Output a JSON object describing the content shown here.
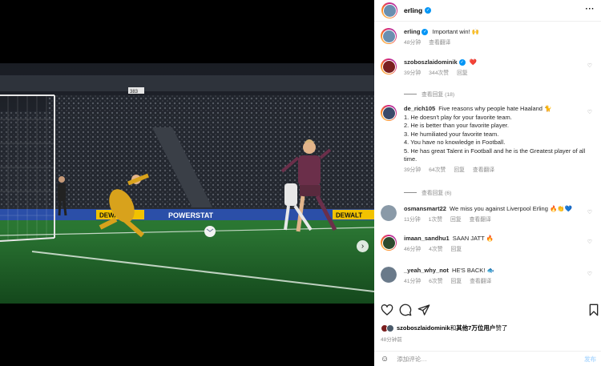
{
  "post": {
    "username": "erling",
    "caption_user": "erling",
    "caption": "Important win! 🙌",
    "caption_time": "48分钟",
    "caption_translate": "查看翻译",
    "carousel_dots": 4,
    "carousel_active": 0
  },
  "photo": {
    "ad_boards": [
      "DEWALT",
      "POWERSTAT",
      "DEWALT"
    ],
    "stand_label": "383"
  },
  "comments": [
    {
      "user": "szoboszlaidominik",
      "verified": true,
      "text": "❤️",
      "time": "39分钟",
      "likes": "344次赞",
      "reply": "回复",
      "translate": "",
      "replies": "查看回复 (18)",
      "avatar_color": "#7a1f1f"
    },
    {
      "user": "de_rich105",
      "verified": false,
      "text": "Five reasons why people hate Haaland 🐈",
      "lines": [
        "1. He doesn't play for your favorite team.",
        "2. He is better than your favorite player.",
        "3. He humiliated your favorite team.",
        "4. You have no knowledge in Football.",
        "5. He has great Talent in Football and he is the Greatest player of all time."
      ],
      "time": "39分钟",
      "likes": "64次赞",
      "reply": "回复",
      "translate": "查看翻译",
      "replies": "查看回复 (6)",
      "avatar_color": "#3a4a6a"
    },
    {
      "user": "osmansmart22",
      "verified": false,
      "text": "We miss you against Liverpool Erling 🔥👏💙",
      "time": "11分钟",
      "likes": "1次赞",
      "reply": "回复",
      "translate": "查看翻译",
      "avatar_color": "#8a9aa8"
    },
    {
      "user": "imaan_sandhu1",
      "verified": false,
      "text": "SAAN JATT 🔥",
      "time": "46分钟",
      "likes": "4次赞",
      "reply": "回复",
      "translate": "",
      "avatar_color": "#2d4a2d"
    },
    {
      "user": "_yeah_why_not",
      "verified": false,
      "text": "HE'S BACK! 🐟",
      "time": "41分钟",
      "likes": "6次赞",
      "reply": "回复",
      "translate": "查看翻译",
      "avatar_color": "#6a7a8a"
    }
  ],
  "likes": {
    "user": "szoboszlaidominik",
    "connector": "和",
    "others": "其他7万位用户",
    "suffix": "赞了",
    "time": "48分钟前"
  },
  "add_comment": {
    "placeholder": "添加评论…",
    "post_label": "发布"
  },
  "icons": {
    "more": "more-horizontal-icon",
    "heart": "heart-icon",
    "comment": "comment-icon",
    "share": "share-icon",
    "bookmark": "bookmark-icon",
    "emoji": "emoji-icon",
    "next": "chevron-right-icon"
  },
  "colors": {
    "verified": "#0095f6",
    "story_ring": [
      "#feda75",
      "#fa7e1e",
      "#d62976",
      "#962fbf"
    ],
    "pitch": "#1f6a2c",
    "sky_city_kit": "#6b2f4a",
    "keeper_kit": "#d8a21c"
  }
}
